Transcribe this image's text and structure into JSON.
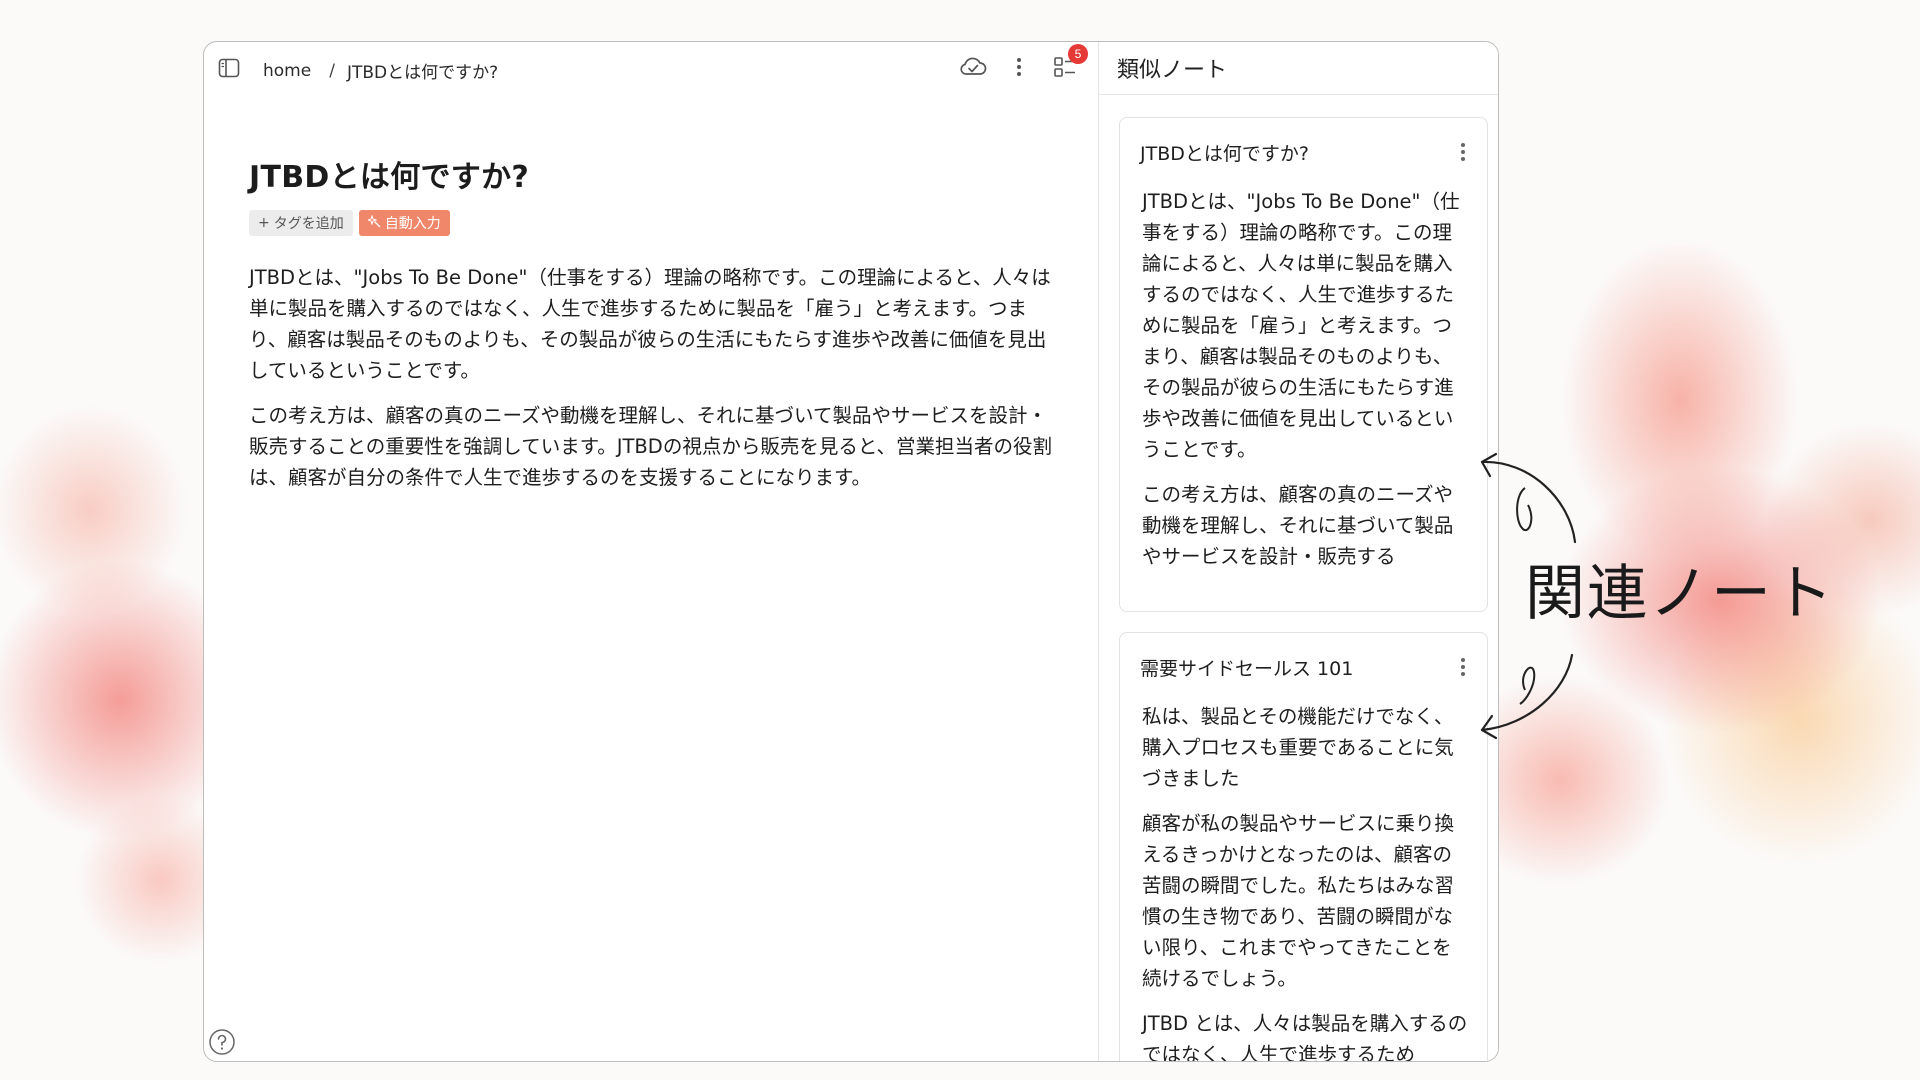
{
  "breadcrumb": {
    "home": "home",
    "separator": "/",
    "current": "JTBDとは何ですか?"
  },
  "toolbar": {
    "badge_count": "5"
  },
  "document": {
    "title": "JTBDとは何ですか?",
    "tags": {
      "add_label": "タグを追加",
      "auto_label": "自動入力"
    },
    "paragraphs": [
      "JTBDとは、\"Jobs To Be Done\"（仕事をする）理論の略称です。この理論によると、人々は単に製品を購入するのではなく、人生で進歩するために製品を「雇う」と考えます。つまり、顧客は製品そのものよりも、その製品が彼らの生活にもたらす進歩や改善に価値を見出しているということです。",
      "この考え方は、顧客の真のニーズや動機を理解し、それに基づいて製品やサービスを設計・販売することの重要性を強調しています。JTBDの視点から販売を見ると、営業担当者の役割は、顧客が自分の条件で人生で進歩するのを支援することになります。"
    ]
  },
  "similar_notes": {
    "header": "類似ノート",
    "cards": [
      {
        "title": "JTBDとは何ですか?",
        "paragraphs": [
          "JTBDとは、\"Jobs To Be Done\"（仕事をする）理論の略称です。この理論によると、人々は単に製品を購入するのではなく、人生で進歩するために製品を「雇う」と考えます。つまり、顧客は製品そのものよりも、その製品が彼らの生活にもたらす進歩や改善に価値を見出しているということです。",
          "この考え方は、顧客の真のニーズや動機を理解し、それに基づいて製品やサービスを設計・販売する"
        ]
      },
      {
        "title": "需要サイドセールス 101",
        "paragraphs": [
          "私は、製品とその機能だけでなく、購入プロセスも重要であることに気づきました",
          "顧客が私の製品やサービスに乗り換えるきっかけとなったのは、顧客の苦闘の瞬間でした。私たちはみな習慣の生き物であり、苦闘の瞬間がない限り、これまでやってきたことを続けるでしょう。",
          "JTBD とは、人々は製品を購入するのではなく、人生で進歩するため"
        ]
      }
    ]
  },
  "annotation": {
    "text": "関連ノート"
  },
  "colors": {
    "accent_tag": "#f0876b",
    "badge": "#e53935",
    "border": "#bdbdbd"
  },
  "icons": [
    "sidebar-toggle-icon",
    "cloud-sync-icon",
    "more-vertical-icon",
    "list-icon",
    "plus-icon",
    "sparkle-icon",
    "help-icon"
  ]
}
